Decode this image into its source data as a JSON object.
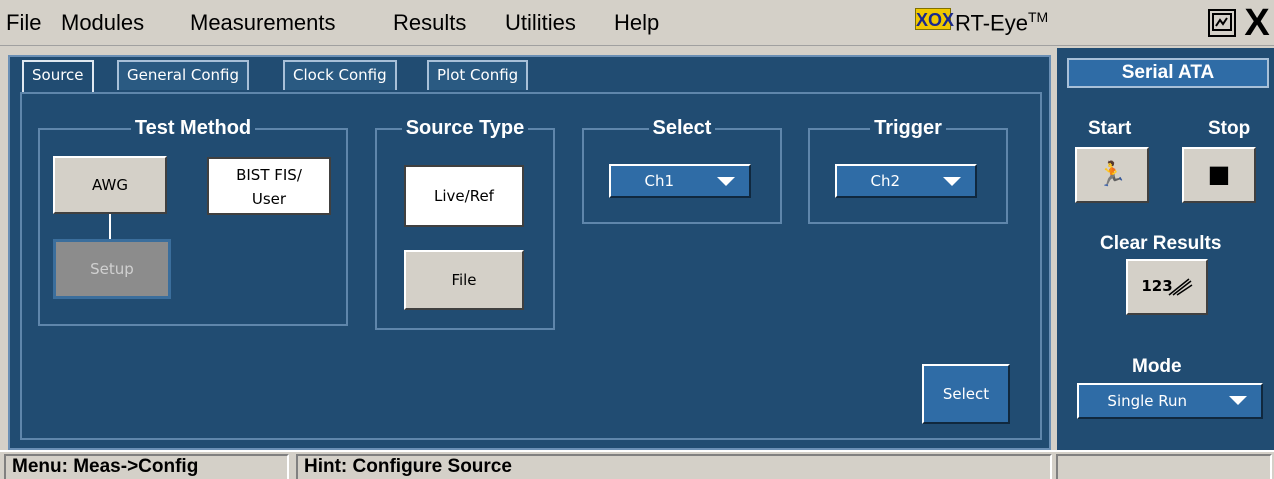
{
  "menu": {
    "items": [
      "File",
      "Modules",
      "Measurements",
      "Results",
      "Utilities",
      "Help"
    ]
  },
  "app": {
    "logo": "XOX",
    "title": "RT-Eye",
    "trademark": "TM",
    "close_glyph": "X"
  },
  "tabs": [
    {
      "label": "Source",
      "active": true
    },
    {
      "label": "General Config",
      "active": false
    },
    {
      "label": "Clock Config",
      "active": false
    },
    {
      "label": "Plot Config",
      "active": false
    }
  ],
  "test_method": {
    "title": "Test Method",
    "awg_label": "AWG",
    "bist_label_line1": "BIST FIS/",
    "bist_label_line2": "User",
    "setup_label": "Setup"
  },
  "source_type": {
    "title": "Source Type",
    "live_ref_label": "Live/Ref",
    "file_label": "File"
  },
  "select_group": {
    "title": "Select",
    "value": "Ch1"
  },
  "trigger_group": {
    "title": "Trigger",
    "value": "Ch2"
  },
  "select_button_label": "Select",
  "right_panel": {
    "header": "Serial ATA",
    "start_label": "Start",
    "stop_label": "Stop",
    "start_glyph": "🏃",
    "stop_glyph": "■",
    "clear_results_label": "Clear Results",
    "clear_glyph": "123",
    "mode_label": "Mode",
    "mode_value": "Single Run"
  },
  "status": {
    "menu": "Menu: Meas->Config",
    "hint": "Hint: Configure Source"
  },
  "colors": {
    "panel_bg": "#214c72",
    "accent_blue": "#2f6ca6",
    "chrome": "#d4d0c8"
  }
}
